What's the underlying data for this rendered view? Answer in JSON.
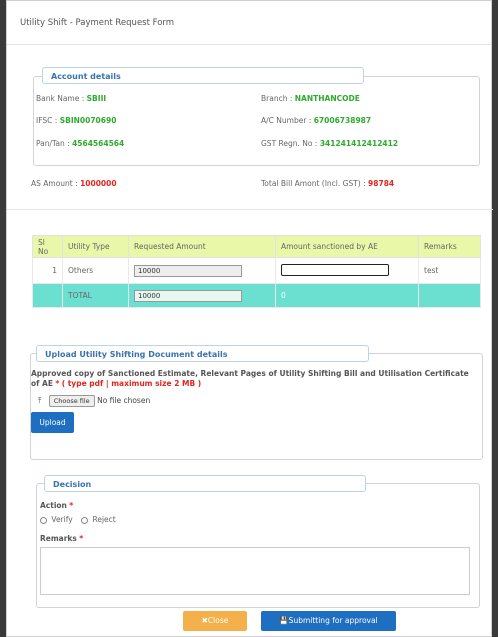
{
  "modal": {
    "title": "Utility Shift - Payment Request Form"
  },
  "account": {
    "legend": "Account details",
    "bank_name_label": "Bank Name :",
    "bank_name": "SBIII",
    "branch_label": "Branch :",
    "branch": "NANTHANCODE",
    "ifsc_label": "IFSC :",
    "ifsc": "SBIN0070690",
    "ac_label": "A/C Number :",
    "ac_number": "67006738987",
    "pan_label": "Pan/Tan :",
    "pan": "4564564564",
    "gst_label": "GST Regn. No :",
    "gst": "341241412412412"
  },
  "amounts": {
    "as_label": "AS Amount :",
    "as_value": "1000000",
    "total_bill_label": "Total Bill Amont (Incl. GST) :",
    "total_bill_value": "98784"
  },
  "table": {
    "headers": [
      "Sl No",
      "Utility Type",
      "Requested Amount",
      "Amount sanctioned by AE",
      "Remarks"
    ],
    "row": {
      "sl": "1",
      "type": "Others",
      "requested": "10000",
      "sanctioned": "",
      "remarks": "test"
    },
    "total": {
      "label": "TOTAL",
      "requested": "10000",
      "sanctioned": "0"
    }
  },
  "upload": {
    "legend": "Upload Utility Shifting Document details",
    "instruction": "Approved copy of Sanctioned Estimate, Relevant Pages of Utility Shifting Bill and Utilisation Certificate of AE",
    "required_mark": "*",
    "note": "( type pdf | maximum size 2 MB )",
    "choose_label": "Choose file",
    "no_file": "No file chosen",
    "upload_button": "Upload"
  },
  "decision": {
    "legend": "Decision",
    "action_label": "Action",
    "required_mark": "*",
    "options": [
      "Verify",
      "Reject"
    ],
    "remarks_label": "Remarks"
  },
  "footer": {
    "close_label": "✖Close",
    "submit_label": "💾Submitting for approval"
  },
  "colors": {
    "accent": "#2f7fd0",
    "total_row": "#6be0d1",
    "header_row": "#e9f7a8",
    "close_btn": "#f4b04a",
    "green_value": "#2eaa2e",
    "red_value": "#e0261f"
  }
}
